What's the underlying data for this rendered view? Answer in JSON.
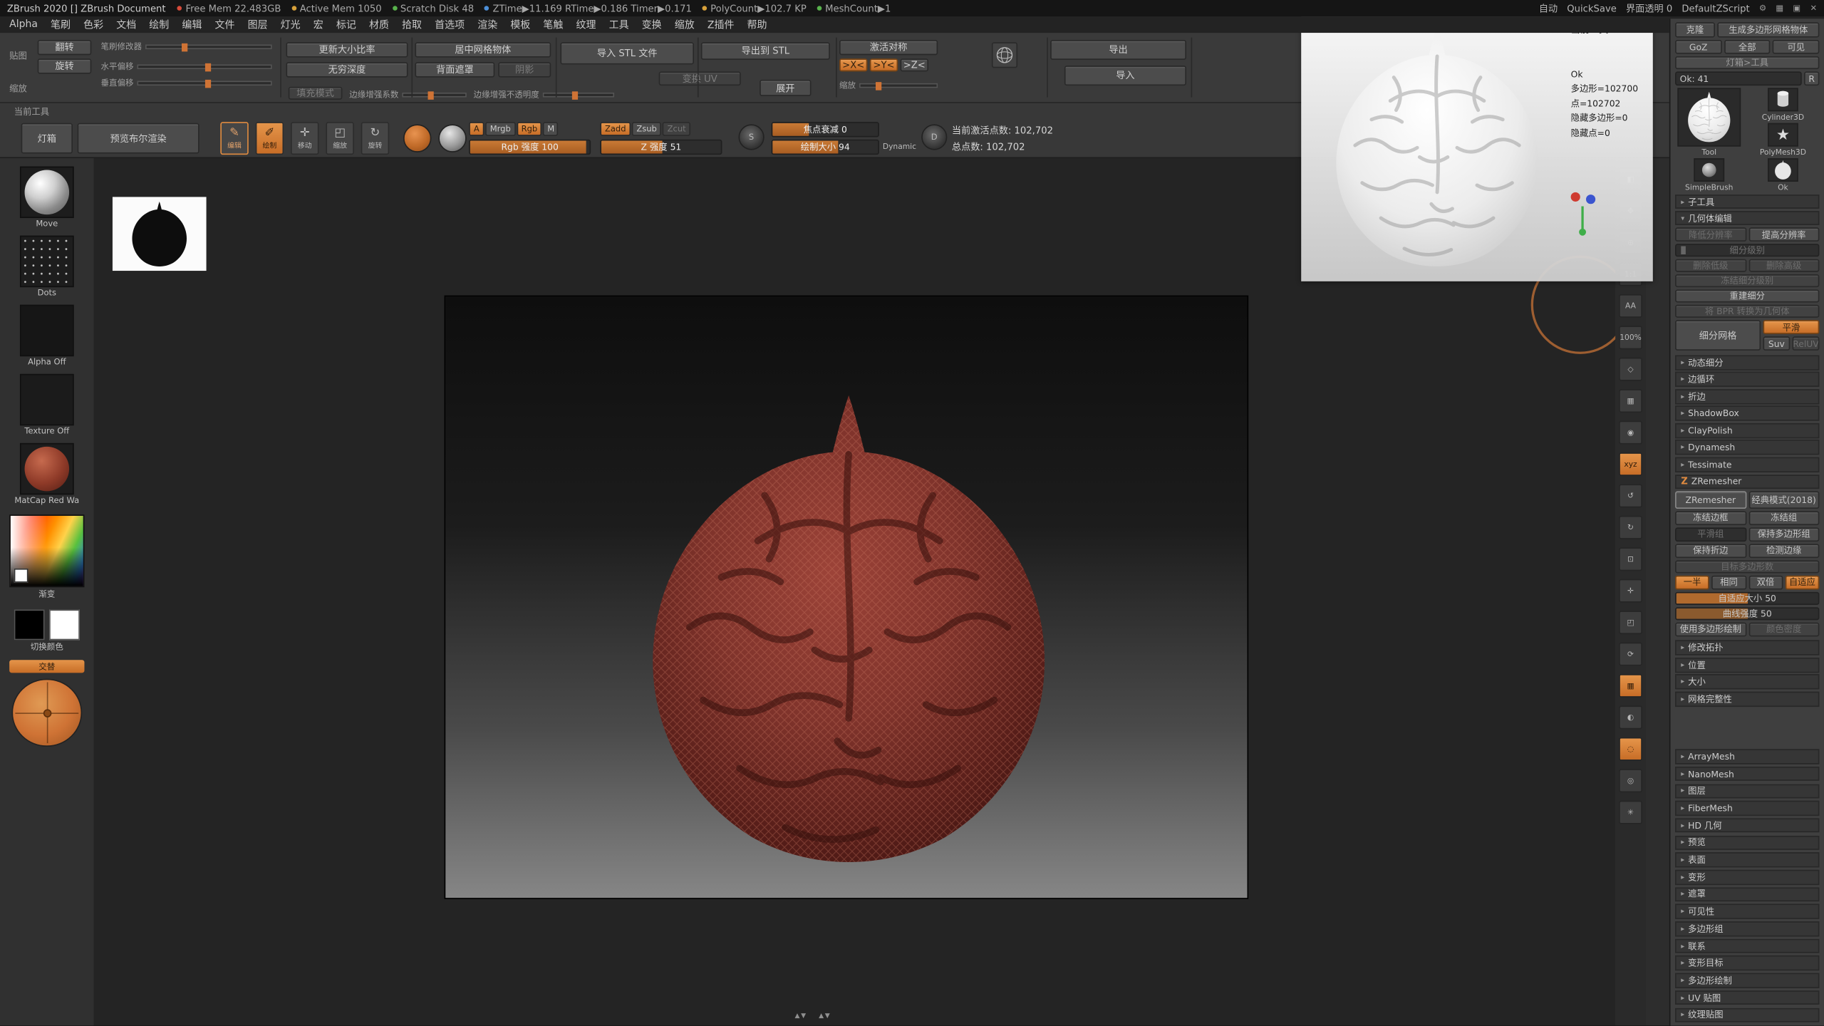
{
  "accent": "#cf7335",
  "icons": {
    "up": "▲",
    "down": "▼",
    "gear": "⚙",
    "menu_grid": "▦",
    "restore": "▣",
    "close": "✕",
    "chev_right": "▸",
    "chev_down": "▾",
    "s": "S",
    "d": "D",
    "star": "★"
  },
  "titlebar": {
    "title": "ZBrush 2020 [] ZBrush Document",
    "stats": [
      {
        "label": "Free Mem 22.483GB",
        "dot": "#d84b3a"
      },
      {
        "label": "Active Mem 1050",
        "dot": "#d8a13a"
      },
      {
        "label": "Scratch Disk 48",
        "dot": "#58b24c"
      },
      {
        "label": "ZTime▶11.169 RTime▶0.186 Timer▶0.171",
        "dot": "#4c8fd8"
      },
      {
        "label": "PolyCount▶102.7 KP",
        "dot": "#d8a13a"
      },
      {
        "label": "MeshCount▶1",
        "dot": "#58b24c"
      }
    ],
    "auto": "自动",
    "quicksave": "QuickSave",
    "ui_transparency": "界面透明 0",
    "zscript": "DefaultZScript"
  },
  "menus": [
    "Alpha",
    "笔刷",
    "色彩",
    "文档",
    "绘制",
    "编辑",
    "文件",
    "图层",
    "灯光",
    "宏",
    "标记",
    "材质",
    "拾取",
    "首选项",
    "渲染",
    "模板",
    "笔触",
    "纹理",
    "工具",
    "变换",
    "缩放",
    "Z插件",
    "帮助"
  ],
  "topshelf": {
    "left_label": "贴图",
    "flip": "翻转",
    "rotate": "旋转",
    "scale_label": "缩放",
    "brush_mod": "笔刷修改器",
    "h_offset": "水平偏移",
    "v_offset": "垂直偏移",
    "fill_mode": "填充模式",
    "edge_factor": "边缘增强系数",
    "edge_opacity": "边缘增强不透明度",
    "update_ratio": "更新大小比率",
    "inf_depth": "无穷深度",
    "center_mesh": "居中网格物体",
    "backface_mask": "背面遮罩",
    "shadow": "阴影",
    "import_stl": "导入 STL 文件",
    "export_stl": "导出到 STL",
    "transform_uv": "变换 UV",
    "unwrap": "展开",
    "activate_symmetry": "激活对称",
    "sym_x": ">X<",
    "sym_y": ">Y<",
    "sym_z": ">Z<",
    "radial_label": "缩放",
    "export": "导出",
    "import": "导入"
  },
  "toolrow": {
    "label": "当前工具",
    "lightbox": "灯箱",
    "live_boolean": "预览布尔渲染",
    "modes": [
      {
        "name": "edit-button",
        "glyph": "✎",
        "label": "编辑",
        "cls": "outline-on"
      },
      {
        "name": "draw-button",
        "glyph": "✐",
        "label": "绘制",
        "cls": "on"
      },
      {
        "name": "move-button",
        "glyph": "✛",
        "label": "移动"
      },
      {
        "name": "scale-button",
        "glyph": "◰",
        "label": "缩放"
      },
      {
        "name": "rotate-button",
        "glyph": "↻",
        "label": "旋转"
      }
    ],
    "paint_modes": [
      {
        "name": "a-toggle",
        "label": "A",
        "cls": "on narrow"
      },
      {
        "name": "mrgb-toggle",
        "label": "Mrgb"
      },
      {
        "name": "rgb-toggle",
        "label": "Rgb",
        "cls": "on"
      },
      {
        "name": "m-toggle",
        "label": "M",
        "cls": "narrow"
      }
    ],
    "rgb_slider_label": "Rgb 强度",
    "rgb_slider_value": "100",
    "sculpt_modes": [
      {
        "name": "zadd-toggle",
        "label": "Zadd",
        "cls": "on"
      },
      {
        "name": "zsub-toggle",
        "label": "Zsub"
      },
      {
        "name": "zcut-toggle",
        "label": "Zcut",
        "cls": "dim"
      }
    ],
    "z_slider_label": "Z 强度",
    "z_slider_value": "51",
    "focal_label": "焦点衰减",
    "focal_value": "0",
    "size_label": "绘制大小",
    "size_value": "94",
    "dynamic": "Dynamic",
    "active_points": "当前激活点数: 102,702",
    "total_points": "总点数: 102,702"
  },
  "tray": {
    "brush_label": "Move",
    "stroke_label": "Dots",
    "alpha_label": "Alpha Off",
    "texture_label": "Texture Off",
    "material_label": "MatCap Red Wa",
    "gradient_label": "渐变",
    "switch_label": "切换颜色",
    "alt_label": "交替"
  },
  "preview": {
    "title": "当前工具",
    "lines": [
      "Ok",
      "多边形=102700",
      "点=102702",
      "隐藏多边形=0",
      "隐藏点=0"
    ]
  },
  "rightshelf": [
    {
      "name": "bpr-icon",
      "glyph": "◧"
    },
    {
      "name": "scroll-icon",
      "glyph": "✥"
    },
    {
      "name": "zoom-icon",
      "glyph": "⊕"
    },
    {
      "name": "actual-size-icon",
      "glyph": "1:1"
    },
    {
      "name": "aa-half-icon",
      "glyph": "AA"
    },
    {
      "name": "zoom-percent-icon",
      "glyph": "100%"
    },
    {
      "name": "persp-icon",
      "glyph": "◇"
    },
    {
      "name": "floor-icon",
      "glyph": "▦"
    },
    {
      "name": "local-icon",
      "glyph": "◉"
    },
    {
      "name": "sxyz-toggle",
      "glyph": "xyz",
      "active": true
    },
    {
      "name": "rotate-left-icon",
      "glyph": "↺"
    },
    {
      "name": "rotate-right-icon",
      "glyph": "↻"
    },
    {
      "name": "frame-icon",
      "glyph": "⊡"
    },
    {
      "name": "move-icon",
      "glyph": "✛"
    },
    {
      "name": "scale-icon",
      "glyph": "◰"
    },
    {
      "name": "rotate-icon",
      "glyph": "⟳"
    },
    {
      "name": "polyframe-toggle",
      "glyph": "▦",
      "active": true
    },
    {
      "name": "transp-icon",
      "glyph": "◐"
    },
    {
      "name": "ghost-toggle",
      "glyph": "◌",
      "active": true
    },
    {
      "name": "solo-icon",
      "glyph": "◎"
    },
    {
      "name": "xpose-icon",
      "glyph": "✳"
    }
  ],
  "tool_panel": {
    "clone": "克隆",
    "make_polymesh": "生成多边形网格物体",
    "goz": "GoZ",
    "all": "全部",
    "visible": "可见",
    "lightbox_tool": "灯箱>工具",
    "tool_name": "Ok: 41",
    "r_button": "R",
    "z_logo": "Z",
    "thumbs": {
      "current_label": "Tool",
      "simplebrush_label": "SimpleBrush",
      "cylinder_label": "Cylinder3D",
      "polymesh_label": "PolyMesh3D",
      "ok_label": "Ok"
    },
    "subtool_header": "子工具",
    "geometry_header": "几何体编辑",
    "lower_res": "降低分辨率",
    "higher_res": "提高分辨率",
    "sdiv": "细分级别",
    "del_lower": "删除低级",
    "del_higher": "删除高级",
    "freeze_sub": "冻结细分级别",
    "reconstruct": "重建细分",
    "bpr_to_geo": "将 BPR 转换为几何体",
    "divide": "细分网格",
    "smt": "平滑",
    "suv": "Suv",
    "reluv": "RelUV",
    "collapsed_geo": [
      "动态细分",
      "边循环",
      "折边",
      "ShadowBox",
      "ClayPolish",
      "Dynamesh",
      "Tessimate"
    ],
    "zremesher_header": "ZRemesher",
    "zremesher_btn": "ZRemesher",
    "legacy": "经典模式(2018)",
    "freeze_border": "冻结边框",
    "freeze_groups": "冻结组",
    "smooth_groups": "平滑组",
    "keep_groups": "保持多边形组",
    "keep_creases": "保持折边",
    "detect_edges": "检测边缘",
    "target_count": "目标多边形数",
    "half": "一半",
    "same": "相同",
    "double": "双倍",
    "adapt": "自适应",
    "adaptive_label": "自适应大小",
    "adaptive_value": "50",
    "curve_label": "曲线强度",
    "curve_value": "50",
    "use_polypaint": "使用多边形绘制",
    "color_density": "颜色密度",
    "collapsed_mid": [
      "修改拓扑",
      "位置",
      "大小",
      "网格完整性"
    ],
    "collapsed_bottom": [
      "ArrayMesh",
      "NanoMesh",
      "图层",
      "FiberMesh",
      "HD 几何",
      "预览",
      "表面",
      "变形",
      "遮罩",
      "可见性",
      "多边形组",
      "联系",
      "变形目标",
      "多边形绘制",
      "UV 贴图",
      "纹理贴图"
    ]
  }
}
